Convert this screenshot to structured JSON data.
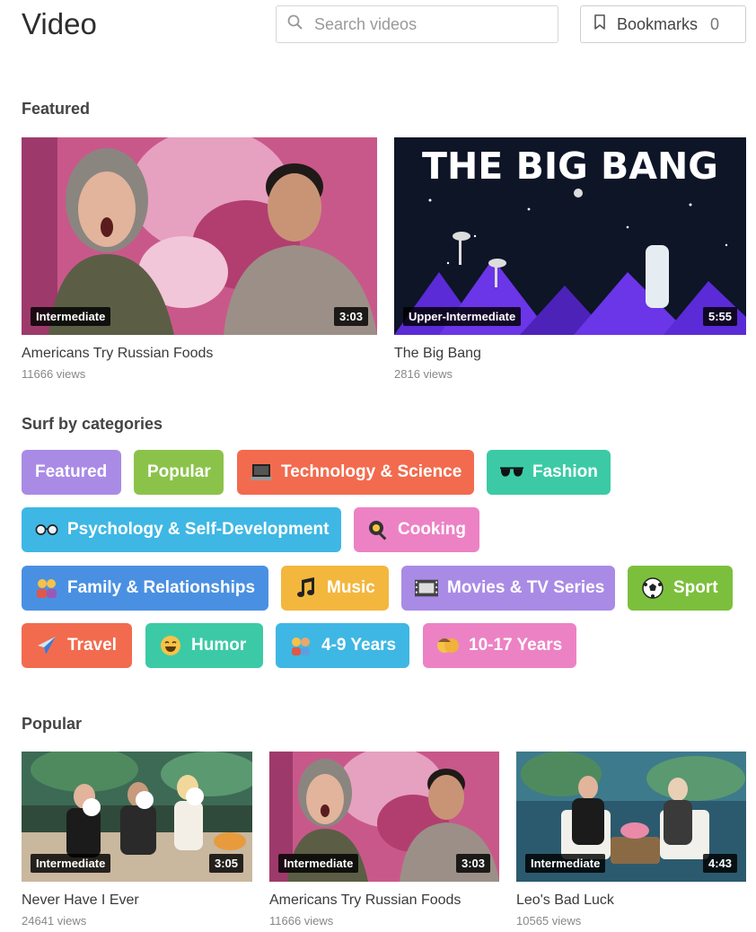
{
  "header": {
    "title": "Video",
    "search_placeholder": "Search videos",
    "bookmarks_label": "Bookmarks",
    "bookmarks_count": "0"
  },
  "featured": {
    "title": "Featured",
    "videos": [
      {
        "title": "Americans Try Russian Foods",
        "views": "11666 views",
        "level": "Intermediate",
        "duration": "3:03"
      },
      {
        "title": "The Big Bang",
        "views": "2816 views",
        "level": "Upper-Intermediate",
        "duration": "5:55",
        "thumb_text": "THE BIG BANG"
      }
    ]
  },
  "categories": {
    "title": "Surf by categories",
    "items": [
      {
        "label": "Featured",
        "color": "#a98be6",
        "icon": "none"
      },
      {
        "label": "Popular",
        "color": "#8bc34a",
        "icon": "none"
      },
      {
        "label": "Technology & Science",
        "color": "#f26b4e",
        "icon": "laptop-icon"
      },
      {
        "label": "Fashion",
        "color": "#3ccaa6",
        "icon": "sunglasses-icon"
      },
      {
        "label": "Psychology & Self-Development",
        "color": "#3fb7e4",
        "icon": "glasses-icon"
      },
      {
        "label": "Cooking",
        "color": "#ec82c4",
        "icon": "frying-pan-icon"
      },
      {
        "label": "Family & Relationships",
        "color": "#4a90e2",
        "icon": "family-icon"
      },
      {
        "label": "Music",
        "color": "#f3b73e",
        "icon": "music-note-icon"
      },
      {
        "label": "Movies & TV Series",
        "color": "#a98be6",
        "icon": "film-strip-icon"
      },
      {
        "label": "Sport",
        "color": "#7cbf3c",
        "icon": "soccer-ball-icon"
      },
      {
        "label": "Travel",
        "color": "#f26b4e",
        "icon": "airplane-icon"
      },
      {
        "label": "Humor",
        "color": "#3ccaa6",
        "icon": "laughing-face-icon"
      },
      {
        "label": "4-9 Years",
        "color": "#3fb7e4",
        "icon": "kids-icon"
      },
      {
        "label": "10-17 Years",
        "color": "#ec82c4",
        "icon": "teen-icon"
      }
    ]
  },
  "popular": {
    "title": "Popular",
    "videos": [
      {
        "title": "Never Have I Ever",
        "views": "24641 views",
        "level": "Intermediate",
        "duration": "3:05"
      },
      {
        "title": "Americans Try Russian Foods",
        "views": "11666 views",
        "level": "Intermediate",
        "duration": "3:03"
      },
      {
        "title": "Leo's Bad Luck",
        "views": "10565 views",
        "level": "Intermediate",
        "duration": "4:43"
      }
    ]
  }
}
